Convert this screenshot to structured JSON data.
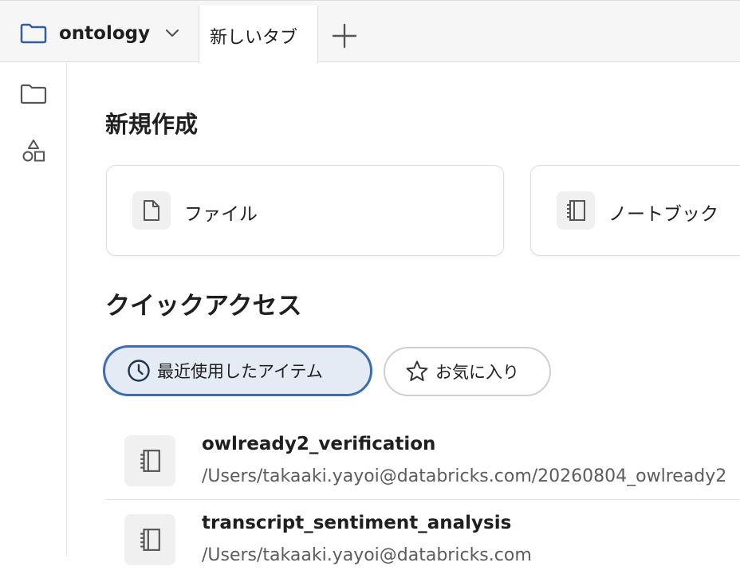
{
  "tabbar": {
    "workspace_name": "ontology",
    "new_tab_label": "新しいタブ"
  },
  "main": {
    "create_heading": "新規作成",
    "create_cards": [
      {
        "label": "ファイル",
        "icon": "file-icon"
      },
      {
        "label": "ノートブック",
        "icon": "notebook-icon"
      }
    ],
    "quick_access_heading": "クイックアクセス",
    "filters": [
      {
        "label": "最近使用したアイテム",
        "icon": "clock-icon",
        "active": true
      },
      {
        "label": "お気に入り",
        "icon": "star-icon",
        "active": false
      }
    ],
    "recent_items": [
      {
        "title": "owlready2_verification",
        "path": "/Users/takaaki.yayoi@databricks.com/20260804_owlready2",
        "icon": "notebook-icon"
      },
      {
        "title": "transcript_sentiment_analysis",
        "path": "/Users/takaaki.yayoi@databricks.com",
        "icon": "notebook-icon"
      }
    ]
  },
  "colors": {
    "accent": "#3e6cb0",
    "active_pill_bg": "#e4ebf5",
    "folder_icon": "#2f5fa0"
  }
}
